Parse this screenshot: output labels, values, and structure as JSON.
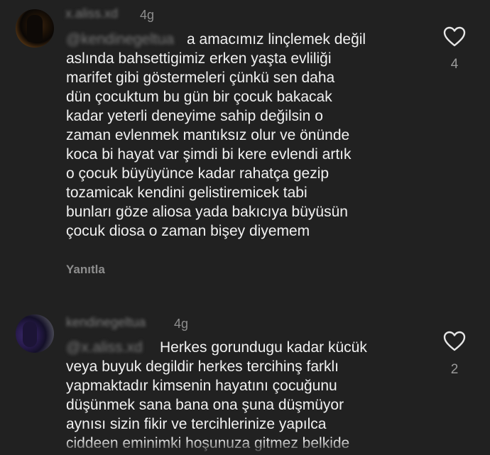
{
  "comments": [
    {
      "username": "x.aliss.xd",
      "time": "4g",
      "mention": "@kendinegeltua",
      "text": "a amacımız linçlemek değil\naslında bahsettigimiz erken yaşta evliliği\nmarifet gibi göstermeleri çünkü sen daha\ndün çocuktum bu gün bir çocuk bakacak\nkadar yeterli deneyime sahip değilsin o\nzaman evlenmek mantıksız olur ve önünde\nkoca bi hayat var şimdi bi kere evlendi artık\no çocuk büyüyünce kadar rahatça gezip\ntozamicak kendini gelistiremicek tabi\nbunları göze aliosa yada bakıcıya büyüsün\nçocuk diosa o zaman bişey diyemem",
      "reply_label": "Yanıtla",
      "likes": "4"
    },
    {
      "username": "kendinegeltua",
      "time": "4g",
      "mention": "@x.aliss.xd",
      "text": "Herkes gorundugu kadar kücük\nveya buyuk degildir herkes tercihinş farklı\nyapmaktadır kimsenin hayatını çocuğunu\ndüşünmek sana bana ona şuna düşmüyor\naynısı sizin fikir ve tercihlerinize yapılca\nciddeen eminimki hoşunuza gitmez belkide",
      "likes": "2"
    }
  ]
}
